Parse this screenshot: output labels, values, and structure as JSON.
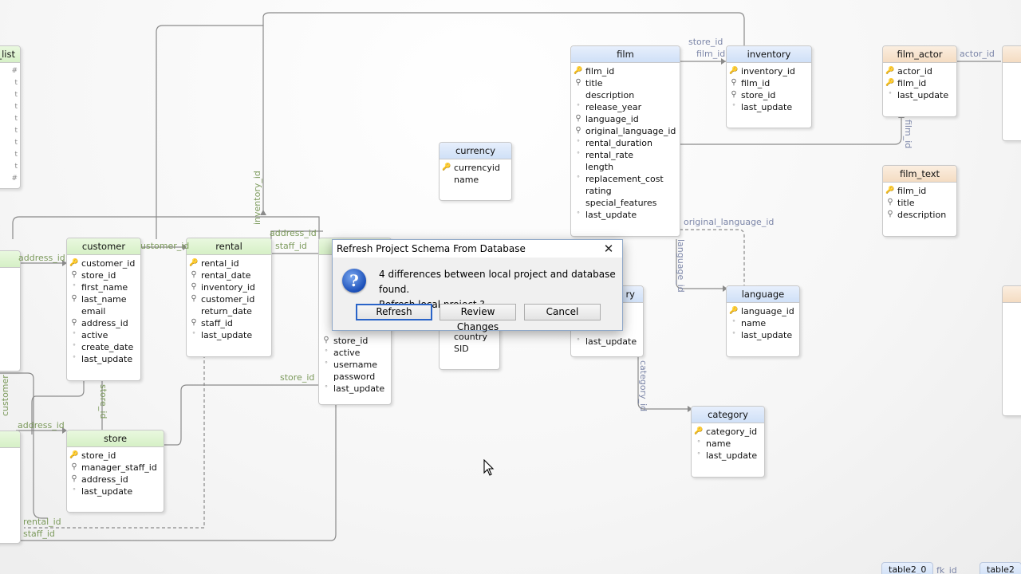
{
  "entities": {
    "film_list": {
      "title": "_list"
    },
    "film": {
      "title": "film",
      "rows": [
        [
          "film_id",
          "pk"
        ],
        [
          "title",
          "fk"
        ],
        [
          "description",
          ""
        ],
        [
          "release_year",
          "nn"
        ],
        [
          "language_id",
          "fk"
        ],
        [
          "original_language_id",
          "fk"
        ],
        [
          "rental_duration",
          "nn"
        ],
        [
          "rental_rate",
          "nn"
        ],
        [
          "length",
          ""
        ],
        [
          "replacement_cost",
          "nn"
        ],
        [
          "rating",
          ""
        ],
        [
          "special_features",
          ""
        ],
        [
          "last_update",
          "nn"
        ]
      ]
    },
    "inventory": {
      "title": "inventory",
      "rows": [
        [
          "inventory_id",
          "pk"
        ],
        [
          "film_id",
          "fk"
        ],
        [
          "store_id",
          "fk"
        ],
        [
          "last_update",
          "nn"
        ]
      ]
    },
    "film_actor": {
      "title": "film_actor",
      "rows": [
        [
          "actor_id",
          "pk"
        ],
        [
          "film_id",
          "pk"
        ],
        [
          "last_update",
          "nn"
        ]
      ]
    },
    "film_text": {
      "title": "film_text",
      "rows": [
        [
          "film_id",
          "pk"
        ],
        [
          "title",
          "fk"
        ],
        [
          "description",
          "fk"
        ]
      ]
    },
    "currency": {
      "title": "currency",
      "rows": [
        [
          "currencyid",
          "pk"
        ],
        [
          "name",
          ""
        ]
      ]
    },
    "customer": {
      "title": "customer",
      "rows": [
        [
          "customer_id",
          "pk"
        ],
        [
          "store_id",
          "fk"
        ],
        [
          "first_name",
          "nn"
        ],
        [
          "last_name",
          "fk"
        ],
        [
          "email",
          ""
        ],
        [
          "address_id",
          "fk"
        ],
        [
          "active",
          "nn"
        ],
        [
          "create_date",
          "nn"
        ],
        [
          "last_update",
          "nn"
        ]
      ]
    },
    "rental": {
      "title": "rental",
      "rows": [
        [
          "rental_id",
          "pk"
        ],
        [
          "rental_date",
          "fk"
        ],
        [
          "inventory_id",
          "fk"
        ],
        [
          "customer_id",
          "fk"
        ],
        [
          "return_date",
          ""
        ],
        [
          "staff_id",
          "fk"
        ],
        [
          "last_update",
          "nn"
        ]
      ]
    },
    "staff": {
      "rows": [
        [
          "store_id",
          "fk"
        ],
        [
          "active",
          "nn"
        ],
        [
          "username",
          "nn"
        ],
        [
          "password",
          ""
        ],
        [
          "last_update",
          "nn"
        ]
      ]
    },
    "country": {
      "rows": [
        [
          "country",
          ""
        ],
        [
          "SID",
          ""
        ]
      ]
    },
    "film_category": {
      "title": "ry",
      "rows": [
        [
          "last_update",
          "nn"
        ]
      ]
    },
    "store": {
      "title": "store",
      "rows": [
        [
          "store_id",
          "pk"
        ],
        [
          "manager_staff_id",
          "fk"
        ],
        [
          "address_id",
          "fk"
        ],
        [
          "last_update",
          "nn"
        ]
      ]
    },
    "language": {
      "title": "language",
      "rows": [
        [
          "language_id",
          "pk"
        ],
        [
          "name",
          "nn"
        ],
        [
          "last_update",
          "nn"
        ]
      ]
    },
    "category": {
      "title": "category",
      "rows": [
        [
          "category_id",
          "pk"
        ],
        [
          "name",
          "nn"
        ],
        [
          "last_update",
          "nn"
        ]
      ]
    }
  },
  "relation_labels": {
    "store_id_top": "store_id",
    "film_id_top": "film_id",
    "actor_id": "actor_id",
    "film_id_v": "film_id",
    "inventory_id_v": "inventory_id",
    "address_id_1": "address_id",
    "address_id_2": "address_id",
    "staff_id": "staff_id",
    "customer_id": "ustomer_id",
    "store_id_mid": "store_id",
    "store_id_v": "store_id",
    "customer_v": "customer",
    "address_id_3": "address_id",
    "rental_id": "rental_id",
    "staff_id_b": "staff_id",
    "original_language_id": "original_language_id",
    "language_id_v": "language_id",
    "category_id_v": "category_id"
  },
  "tabs": {
    "table2_0": "table2_0",
    "fk_id": "fk_id",
    "table2": "table2"
  },
  "dialog": {
    "title": "Refresh Project Schema From Database",
    "message_line1": "4 differences between local project and database found.",
    "message_line2": "Refresh local project ?",
    "icon": "?",
    "refresh_button": "Refresh",
    "review_button": "Review Changes",
    "cancel_button": "Cancel"
  },
  "colors": {
    "green_header": "#d6f0c6",
    "blue_header": "#cfe0f7",
    "tan_header": "#f4dcc2",
    "line": "#8a8a8a"
  }
}
